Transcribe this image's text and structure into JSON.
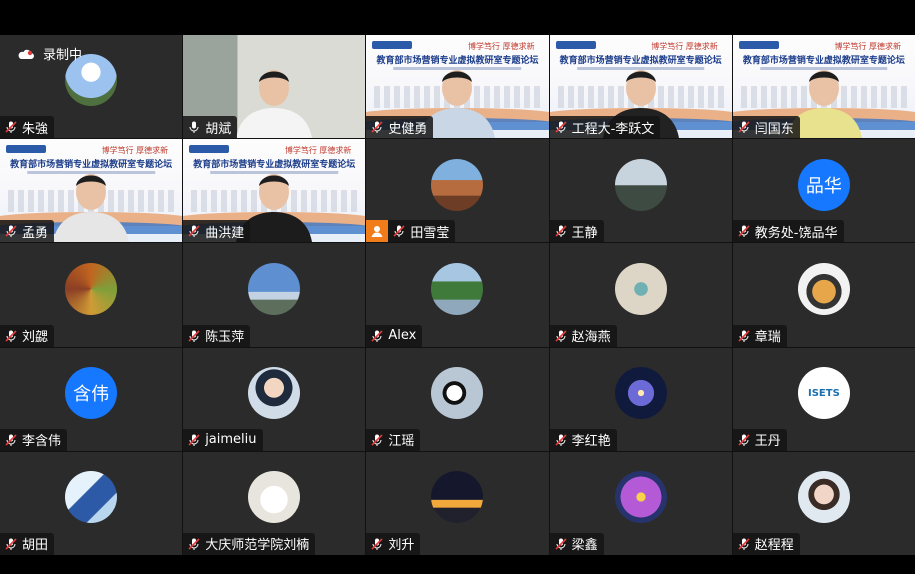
{
  "recording": {
    "label": "录制中"
  },
  "participants": [
    {
      "name": "朱強",
      "kind": "avatar-photo",
      "avatar": "sky-photo",
      "mic": "muted"
    },
    {
      "name": "胡斌",
      "kind": "camera-office",
      "mic": "on"
    },
    {
      "name": "史健勇",
      "kind": "camera-slide",
      "mic": "muted"
    },
    {
      "name": "工程大-李跃文",
      "kind": "camera-slide",
      "mic": "muted"
    },
    {
      "name": "闫国东",
      "kind": "camera-slide",
      "mic": "muted"
    },
    {
      "name": "孟勇",
      "kind": "camera-slide",
      "mic": "muted"
    },
    {
      "name": "曲洪建",
      "kind": "camera-slide",
      "mic": "muted"
    },
    {
      "name": "田雪莹",
      "kind": "avatar-photo",
      "avatar": "canyon-photo",
      "mic": "muted",
      "host": true
    },
    {
      "name": "王静",
      "kind": "avatar-photo",
      "avatar": "portrait-photo",
      "mic": "muted"
    },
    {
      "name": "教务处-饶品华",
      "kind": "avatar-text",
      "avatar_text": "品华",
      "mic": "muted"
    },
    {
      "name": "刘勰",
      "kind": "avatar-photo",
      "avatar": "abstract-photo",
      "mic": "muted"
    },
    {
      "name": "陈玉萍",
      "kind": "avatar-photo",
      "avatar": "bridge-photo",
      "mic": "muted"
    },
    {
      "name": "Alex",
      "kind": "avatar-photo",
      "avatar": "park-photo",
      "mic": "muted"
    },
    {
      "name": "赵海燕",
      "kind": "avatar-photo",
      "avatar": "hourglass-photo",
      "mic": "muted"
    },
    {
      "name": "章瑞",
      "kind": "avatar-photo",
      "avatar": "astronaut-photo",
      "mic": "muted"
    },
    {
      "name": "李含伟",
      "kind": "avatar-text",
      "avatar_text": "含伟",
      "mic": "muted"
    },
    {
      "name": "jaimeliu",
      "kind": "avatar-photo",
      "avatar": "cartoon-photo",
      "mic": "muted"
    },
    {
      "name": "江瑶",
      "kind": "avatar-photo",
      "avatar": "panda-photo",
      "mic": "muted"
    },
    {
      "name": "李红艳",
      "kind": "avatar-photo",
      "avatar": "galaxy-photo",
      "mic": "muted"
    },
    {
      "name": "王丹",
      "kind": "avatar-logo",
      "avatar_text": "ISETS",
      "mic": "muted"
    },
    {
      "name": "胡田",
      "kind": "avatar-photo",
      "avatar": "ice-photo",
      "mic": "muted"
    },
    {
      "name": "大庆师范学院刘楠",
      "kind": "avatar-photo",
      "avatar": "robot-photo",
      "mic": "muted"
    },
    {
      "name": "刘升",
      "kind": "avatar-photo",
      "avatar": "night-photo",
      "mic": "muted"
    },
    {
      "name": "梁鑫",
      "kind": "avatar-photo",
      "avatar": "lotus-photo",
      "mic": "muted"
    },
    {
      "name": "赵程程",
      "kind": "avatar-photo",
      "avatar": "selfie-photo",
      "mic": "muted"
    }
  ],
  "slide": {
    "title": "教育部市场营销专业虚拟教研室专题论坛",
    "slogan": "博学笃行  厚德求新"
  },
  "colors": {
    "accent": "#1677ff",
    "host_badge": "#f07c1a",
    "mic_muted": "#e23b3b"
  }
}
